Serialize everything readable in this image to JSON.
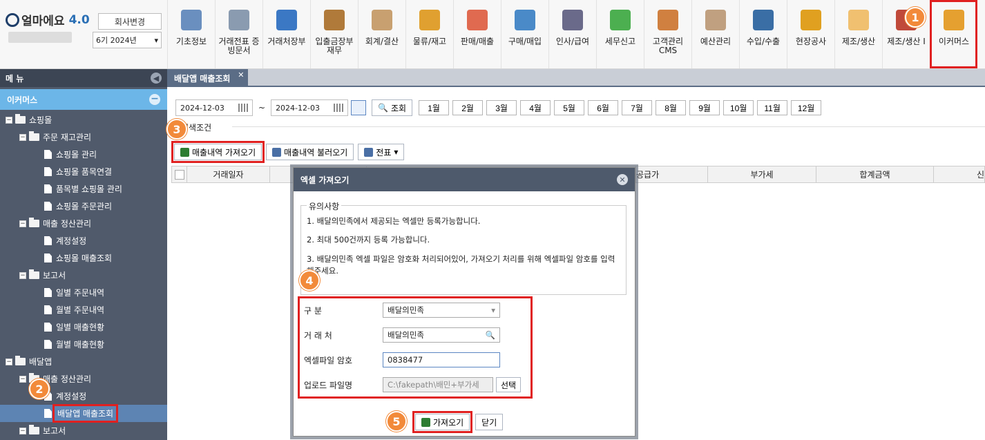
{
  "brand": {
    "name": "얼마에요",
    "version": "4.0"
  },
  "company": {
    "change_label": "회사변경",
    "period": "6기 2024년"
  },
  "menu": [
    "기초정보",
    "거래전표 증빙문서",
    "거래처장부",
    "입출금장부 재무",
    "회계/결산",
    "물류/재고",
    "판매/매출",
    "구매/매입",
    "인사/급여",
    "세무신고",
    "고객관리 CMS",
    "예산관리",
    "수입/수출",
    "현장공사",
    "제조/생산",
    "제조/생산 I",
    "이커머스"
  ],
  "menu_colors": [
    "#6a8fbf",
    "#8a9bb0",
    "#3b78c4",
    "#b07a3a",
    "#c8a070",
    "#e0a030",
    "#e06a50",
    "#4a8ac8",
    "#6a6a8a",
    "#4caf50",
    "#d08040",
    "#c0a080",
    "#3a6ea5",
    "#e0a020",
    "#f0c070",
    "#c04a3a",
    "#e5a030"
  ],
  "sidebar": {
    "title": "메 뉴",
    "category": "이커머스",
    "items": [
      {
        "label": "쇼핑몰",
        "level": 0,
        "type": "folder"
      },
      {
        "label": "주문 재고관리",
        "level": 1,
        "type": "folder"
      },
      {
        "label": "쇼핑몰 관리",
        "level": 2,
        "type": "doc"
      },
      {
        "label": "쇼핑몰 품목연결",
        "level": 2,
        "type": "doc"
      },
      {
        "label": "품목별 쇼핑몰 관리",
        "level": 2,
        "type": "doc"
      },
      {
        "label": "쇼핑몰 주문관리",
        "level": 2,
        "type": "doc"
      },
      {
        "label": "매출 정산관리",
        "level": 1,
        "type": "folder"
      },
      {
        "label": "계정설정",
        "level": 2,
        "type": "doc"
      },
      {
        "label": "쇼핑몰 매출조회",
        "level": 2,
        "type": "doc"
      },
      {
        "label": "보고서",
        "level": 1,
        "type": "folder"
      },
      {
        "label": "일별 주문내역",
        "level": 2,
        "type": "doc"
      },
      {
        "label": "월별 주문내역",
        "level": 2,
        "type": "doc"
      },
      {
        "label": "일별 매출현황",
        "level": 2,
        "type": "doc"
      },
      {
        "label": "월별 매출현황",
        "level": 2,
        "type": "doc"
      },
      {
        "label": "배달앱",
        "level": 0,
        "type": "folder"
      },
      {
        "label": "매출 정산관리",
        "level": 1,
        "type": "folder"
      },
      {
        "label": "계정설정",
        "level": 2,
        "type": "doc"
      },
      {
        "label": "배달앱 매출조회",
        "level": 2,
        "type": "doc",
        "selected": true
      },
      {
        "label": "보고서",
        "level": 1,
        "type": "folder"
      }
    ]
  },
  "tab": {
    "label": "배달앱 매출조회"
  },
  "filters": {
    "date_from": "2024-12-03",
    "date_to": "2024-12-03",
    "search_label": "조회",
    "months": [
      "1월",
      "2월",
      "3월",
      "4월",
      "5월",
      "6월",
      "7월",
      "8월",
      "9월",
      "10월",
      "11월",
      "12월"
    ],
    "condition_label": "검색조건"
  },
  "toolbar": {
    "import_label": "매출내역 가져오기",
    "load_label": "매출내역 불러오기",
    "voucher_label": "전표"
  },
  "grid": {
    "columns": [
      "거래일자",
      "",
      "",
      "공급가",
      "부가세",
      "합계금액",
      "신"
    ]
  },
  "dialog": {
    "title": "엑셀 가져오기",
    "notice_title": "유의사항",
    "notices": [
      "1. 배달의민족에서 제공되는 엑셀만 등록가능합니다.",
      "2. 최대 500건까지 등록 가능합니다.",
      "3. 배달의민족 엑셀 파일은 암호화 처리되어있어, 가져오기 처리를 위해 엑셀파일 암호를 입력해주세요."
    ],
    "fields": {
      "category_label": "구 분",
      "category_value": "배달의민족",
      "partner_label": "거 래 처",
      "partner_value": "배달의민족",
      "password_label": "엑셀파일 암호",
      "password_value": "0838477",
      "upload_label": "업로드 파일명",
      "upload_value": "C:\\fakepath\\배민+부가세",
      "select_label": "선택"
    },
    "fetch_label": "가져오기",
    "close_label": "닫기"
  },
  "badges": [
    "1",
    "2",
    "3",
    "4",
    "5"
  ]
}
